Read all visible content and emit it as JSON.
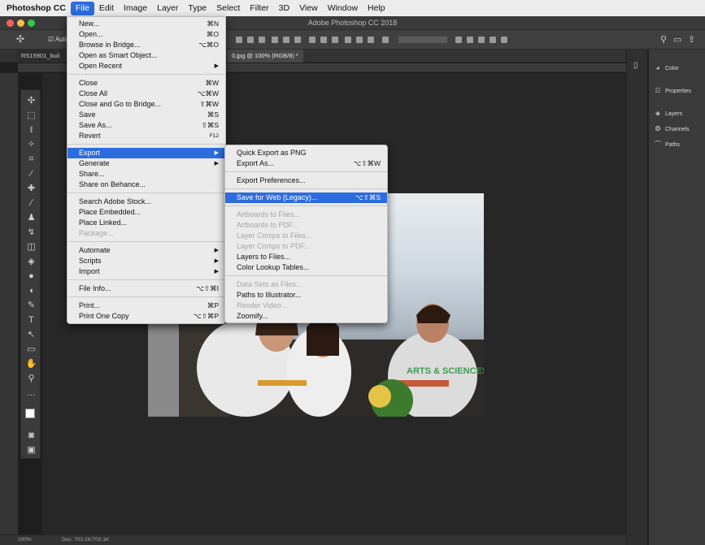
{
  "menubar": {
    "items": [
      "Photoshop CC",
      "File",
      "Edit",
      "Image",
      "Layer",
      "Type",
      "Select",
      "Filter",
      "3D",
      "View",
      "Window",
      "Help"
    ],
    "active": "File"
  },
  "window": {
    "title": "Adobe Photoshop CC 2018"
  },
  "tabs": {
    "doc1": "RS15901_buil",
    "doc2": "0.jpg @ 100% (RGB/8) *"
  },
  "options": {
    "auto_label": "Auto"
  },
  "file_menu": {
    "items": [
      {
        "label": "New...",
        "shortcut": "⌘N"
      },
      {
        "label": "Open...",
        "shortcut": "⌘O"
      },
      {
        "label": "Browse in Bridge...",
        "shortcut": "⌥⌘O"
      },
      {
        "label": "Open as Smart Object...",
        "shortcut": ""
      },
      {
        "label": "Open Recent",
        "shortcut": "",
        "submenu": true
      },
      {
        "label": "Close",
        "shortcut": "⌘W"
      },
      {
        "label": "Close All",
        "shortcut": "⌥⌘W"
      },
      {
        "label": "Close and Go to Bridge...",
        "shortcut": "⇧⌘W"
      },
      {
        "label": "Save",
        "shortcut": "⌘S"
      },
      {
        "label": "Save As...",
        "shortcut": "⇧⌘S"
      },
      {
        "label": "Revert",
        "shortcut": "F12"
      },
      {
        "label": "Export",
        "shortcut": "",
        "submenu": true,
        "highlighted": true
      },
      {
        "label": "Generate",
        "shortcut": "",
        "submenu": true
      },
      {
        "label": "Share...",
        "shortcut": ""
      },
      {
        "label": "Share on Behance...",
        "shortcut": ""
      },
      {
        "label": "Search Adobe Stock...",
        "shortcut": ""
      },
      {
        "label": "Place Embedded...",
        "shortcut": ""
      },
      {
        "label": "Place Linked...",
        "shortcut": ""
      },
      {
        "label": "Package...",
        "shortcut": "",
        "disabled": true
      },
      {
        "label": "Automate",
        "shortcut": "",
        "submenu": true
      },
      {
        "label": "Scripts",
        "shortcut": "",
        "submenu": true
      },
      {
        "label": "Import",
        "shortcut": "",
        "submenu": true
      },
      {
        "label": "File Info...",
        "shortcut": "⌥⇧⌘I"
      },
      {
        "label": "Print...",
        "shortcut": "⌘P"
      },
      {
        "label": "Print One Copy",
        "shortcut": "⌥⇧⌘P"
      }
    ]
  },
  "export_menu": {
    "items": [
      {
        "label": "Quick Export as PNG",
        "shortcut": ""
      },
      {
        "label": "Export As...",
        "shortcut": "⌥⇧⌘W"
      },
      {
        "label": "Export Preferences...",
        "shortcut": ""
      },
      {
        "label": "Save for Web (Legacy)...",
        "shortcut": "⌥⇧⌘S",
        "highlighted": true
      },
      {
        "label": "Artboards to Files...",
        "shortcut": "",
        "disabled": true
      },
      {
        "label": "Artboards to PDF...",
        "shortcut": "",
        "disabled": true
      },
      {
        "label": "Layer Comps to Files...",
        "shortcut": "",
        "disabled": true
      },
      {
        "label": "Layer Comps to PDF...",
        "shortcut": "",
        "disabled": true
      },
      {
        "label": "Layers to Files...",
        "shortcut": ""
      },
      {
        "label": "Color Lookup Tables...",
        "shortcut": ""
      },
      {
        "label": "Data Sets as Files...",
        "shortcut": "",
        "disabled": true
      },
      {
        "label": "Paths to Illustrator...",
        "shortcut": ""
      },
      {
        "label": "Render Video...",
        "shortcut": "",
        "disabled": true
      },
      {
        "label": "Zoomify...",
        "shortcut": ""
      }
    ]
  },
  "panels": {
    "items": [
      "Color",
      "Properties",
      "Layers",
      "Channels",
      "Paths"
    ]
  },
  "status": {
    "zoom": "100%",
    "doc": "Doc: 703.1K/703.1K"
  },
  "photo": {
    "shirt_text": "ARTS & SCIENCES"
  },
  "colors": {
    "highlight": "#2d6cdf",
    "menu_bg": "#ebebeb"
  }
}
